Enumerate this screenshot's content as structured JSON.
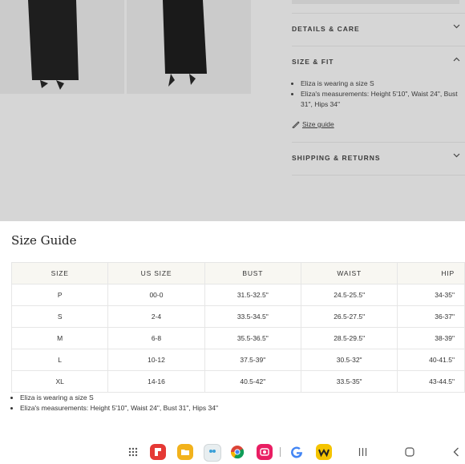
{
  "product": {
    "accordions": [
      {
        "label": "DETAILS & CARE",
        "state": "collapsed"
      },
      {
        "label": "SIZE & FIT",
        "state": "expanded"
      },
      {
        "label": "SHIPPING & RETURNS",
        "state": "collapsed"
      }
    ],
    "fit_bullets": [
      "Eliza is wearing a size S",
      "Eliza's measurements: Height 5'10\", Waist 24\", Bust 31\", Hips 34\""
    ],
    "size_guide_link": "Size guide"
  },
  "size_guide": {
    "title": "Size Guide",
    "headers": [
      "SIZE",
      "US SIZE",
      "BUST",
      "WAIST",
      "HIP"
    ],
    "rows": [
      [
        "P",
        "00-0",
        "31.5-32.5\"",
        "24.5-25.5\"",
        "34-35\""
      ],
      [
        "S",
        "2-4",
        "33.5-34.5\"",
        "26.5-27.5\"",
        "36-37\""
      ],
      [
        "M",
        "6-8",
        "35.5-36.5\"",
        "28.5-29.5\"",
        "38-39\""
      ],
      [
        "L",
        "10-12",
        "37.5-39\"",
        "30.5-32\"",
        "40-41.5\""
      ],
      [
        "XL",
        "14-16",
        "40.5-42\"",
        "33.5-35\"",
        "43-44.5\""
      ]
    ],
    "bullets": [
      "Eliza is wearing a size S",
      "Eliza's measurements: Height 5'10\", Waist 24\", Bust 31\", Hips 34\""
    ]
  },
  "dock": {
    "apps": [
      {
        "name": "app-drawer-icon",
        "color": "#555555"
      },
      {
        "name": "flipboard-icon",
        "color": "#e53935"
      },
      {
        "name": "files-icon",
        "color": "#f2b21c"
      },
      {
        "name": "assistant-icon",
        "color": "#e8eef0"
      },
      {
        "name": "chrome-icon",
        "color": "#4285f4"
      },
      {
        "name": "camera-icon",
        "color": "#e91e63"
      },
      {
        "name": "google-icon",
        "color": "#4285f4"
      },
      {
        "name": "wattpad-icon",
        "color": "#f5c400"
      }
    ],
    "nav": [
      "recents-icon",
      "home-icon",
      "back-icon"
    ]
  }
}
